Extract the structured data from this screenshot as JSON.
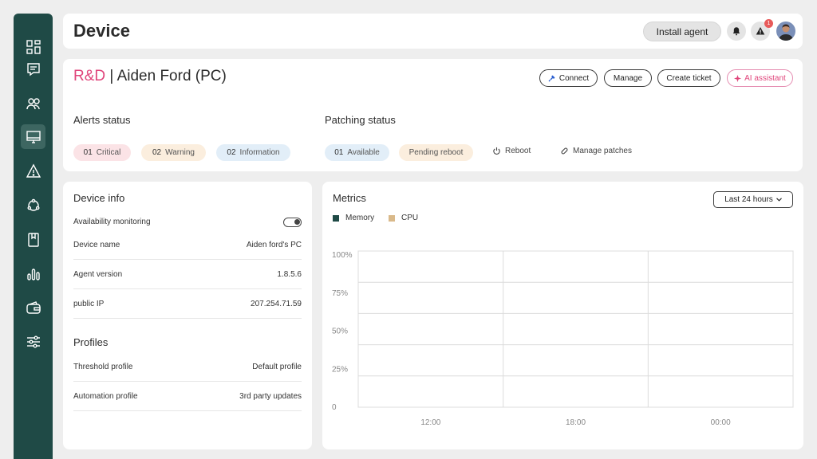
{
  "sidebar": {
    "items": [
      {
        "icon": "dashboard-icon",
        "active": false
      },
      {
        "icon": "chat-icon",
        "active": false
      },
      {
        "icon": "users-icon",
        "active": false
      },
      {
        "icon": "monitor-icon",
        "active": true
      },
      {
        "icon": "alert-icon",
        "active": false
      },
      {
        "icon": "network-icon",
        "active": false
      },
      {
        "icon": "book-icon",
        "active": false
      },
      {
        "icon": "bar-chart-icon",
        "active": false
      },
      {
        "icon": "wallet-icon",
        "active": false
      },
      {
        "icon": "sliders-icon",
        "active": false
      }
    ]
  },
  "header": {
    "title": "Device",
    "install_label": "Install agent",
    "notification_count": "1"
  },
  "device": {
    "department": "R&D",
    "separator": " | ",
    "name": "Aiden Ford (PC)",
    "actions": {
      "connect": "Connect",
      "manage": "Manage",
      "create_ticket": "Create ticket",
      "ai_assistant": "AI assistant"
    },
    "alerts": {
      "label": "Alerts status",
      "critical": {
        "num": "01",
        "label": "Critical"
      },
      "warning": {
        "num": "02",
        "label": "Warning"
      },
      "information": {
        "num": "02",
        "label": "Information"
      }
    },
    "patching": {
      "label": "Patching status",
      "available": {
        "num": "01",
        "label": "Available"
      },
      "pending": "Pending reboot",
      "reboot": "Reboot",
      "manage_patches": "Manage patches"
    }
  },
  "device_info": {
    "title": "Device info",
    "availability_label": "Availability monitoring",
    "rows": [
      {
        "label": "Device name",
        "value": "Aiden ford's PC"
      },
      {
        "label": "Agent version",
        "value": "1.8.5.6"
      },
      {
        "label": "public IP",
        "value": "207.254.71.59"
      }
    ],
    "profiles_title": "Profiles",
    "profiles": [
      {
        "label": "Threshold profile",
        "value": "Default profile"
      },
      {
        "label": "Automation profile",
        "value": "3rd party updates"
      }
    ]
  },
  "metrics": {
    "title": "Metrics",
    "time_range": "Last 24 hours",
    "legend": [
      {
        "name": "Memory",
        "color": "#1f4a46"
      },
      {
        "name": "CPU",
        "color": "#d9b98a"
      }
    ]
  },
  "chart_data": {
    "type": "line",
    "title": "",
    "series": [
      {
        "name": "Memory",
        "values": []
      },
      {
        "name": "CPU",
        "values": []
      }
    ],
    "y_tick_labels": [
      "100%",
      "75%",
      "50%",
      "25%",
      "0"
    ],
    "x_tick_labels": [
      "12:00",
      "18:00",
      "00:00"
    ],
    "ylim": [
      0,
      100
    ],
    "grid": true,
    "legend": "top-left"
  }
}
